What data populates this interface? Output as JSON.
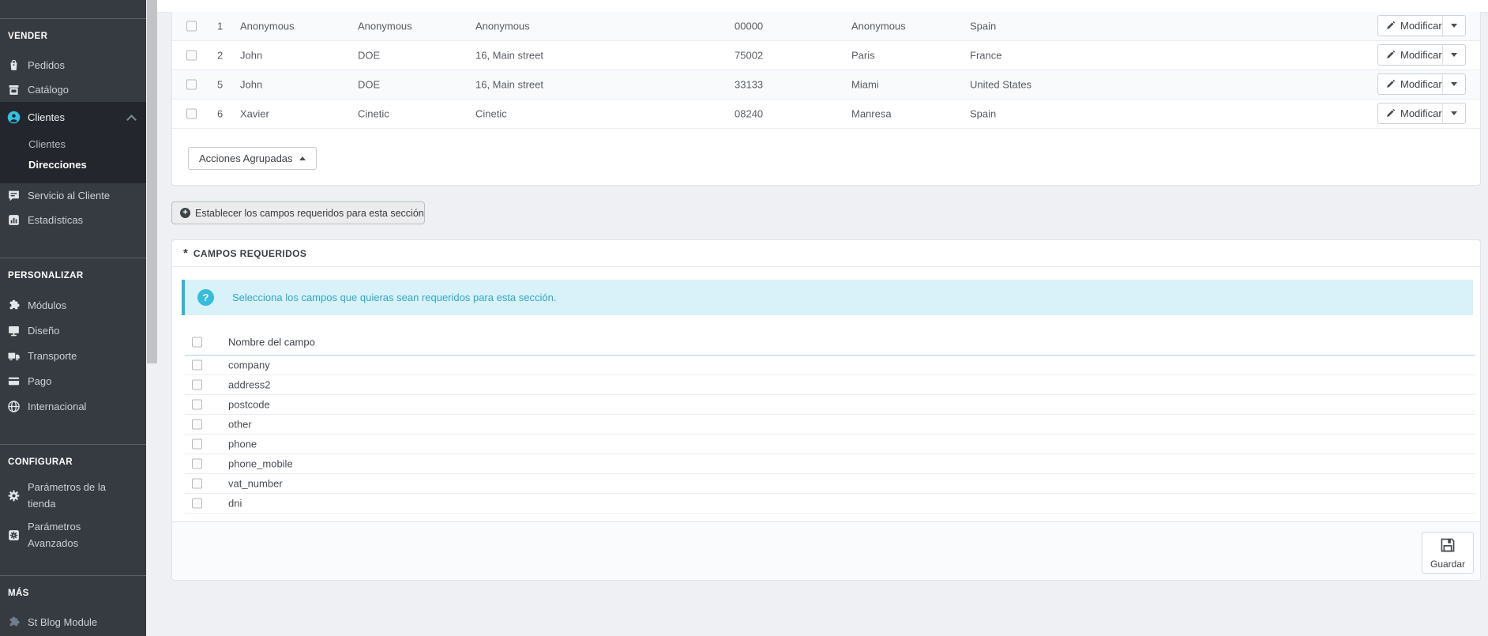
{
  "sidebar": {
    "sections": [
      {
        "title": "VENDER",
        "items": [
          {
            "icon": "orders-icon",
            "label": "Pedidos"
          },
          {
            "icon": "catalog-icon",
            "label": "Catálogo"
          },
          {
            "icon": "customers-icon",
            "label": "Clientes",
            "active": true,
            "expanded": true,
            "children": [
              {
                "label": "Clientes"
              },
              {
                "label": "Direcciones",
                "active": true
              }
            ]
          },
          {
            "icon": "customer-service-icon",
            "label": "Servicio al Cliente"
          },
          {
            "icon": "stats-icon",
            "label": "Estadísticas"
          }
        ]
      },
      {
        "title": "PERSONALIZAR",
        "items": [
          {
            "icon": "modules-icon",
            "label": "Módulos"
          },
          {
            "icon": "design-icon",
            "label": "Diseño"
          },
          {
            "icon": "shipping-icon",
            "label": "Transporte"
          },
          {
            "icon": "payment-icon",
            "label": "Pago"
          },
          {
            "icon": "international-icon",
            "label": "Internacional"
          }
        ]
      },
      {
        "title": "CONFIGURAR",
        "items": [
          {
            "icon": "shop-parameters-icon",
            "label": "Parámetros de la tienda"
          },
          {
            "icon": "advanced-parameters-icon",
            "label": "Parámetros Avanzados"
          }
        ]
      },
      {
        "title": "MÁS",
        "items": [
          {
            "icon": "module-icon",
            "label": "St Blog Module",
            "muted": true
          }
        ]
      }
    ]
  },
  "addresses": {
    "rows": [
      {
        "id": "1",
        "firstname": "Anonymous",
        "lastname": "Anonymous",
        "address": "Anonymous",
        "zipcode": "00000",
        "city": "Anonymous",
        "country": "Spain"
      },
      {
        "id": "2",
        "firstname": "John",
        "lastname": "DOE",
        "address": "16, Main street",
        "zipcode": "75002",
        "city": "Paris",
        "country": "France"
      },
      {
        "id": "5",
        "firstname": "John",
        "lastname": "DOE",
        "address": "16, Main street",
        "zipcode": "33133",
        "city": "Miami",
        "country": "United States"
      },
      {
        "id": "6",
        "firstname": "Xavier",
        "lastname": "Cinetic",
        "address": "Cinetic",
        "zipcode": "08240",
        "city": "Manresa",
        "country": "Spain"
      }
    ],
    "edit_label": "Modificar",
    "bulk_actions_label": "Acciones Agrupadas"
  },
  "set_required_button": {
    "label": "Establecer los campos requeridos para esta sección",
    "plus_glyph": "+"
  },
  "required_fields_panel": {
    "title": "CAMPOS REQUERIDOS",
    "title_icon_glyph": "*",
    "info_text": "Selecciona los campos que quieras sean requeridos para esta sección.",
    "info_icon_glyph": "?",
    "column_header": "Nombre del campo",
    "fields": [
      "company",
      "address2",
      "postcode",
      "other",
      "phone",
      "phone_mobile",
      "vat_number",
      "dni"
    ],
    "save_label": "Guardar"
  },
  "colors": {
    "accent": "#25b9d7",
    "sidebar_bg": "#363a41",
    "page_bg": "#eef0f3"
  }
}
